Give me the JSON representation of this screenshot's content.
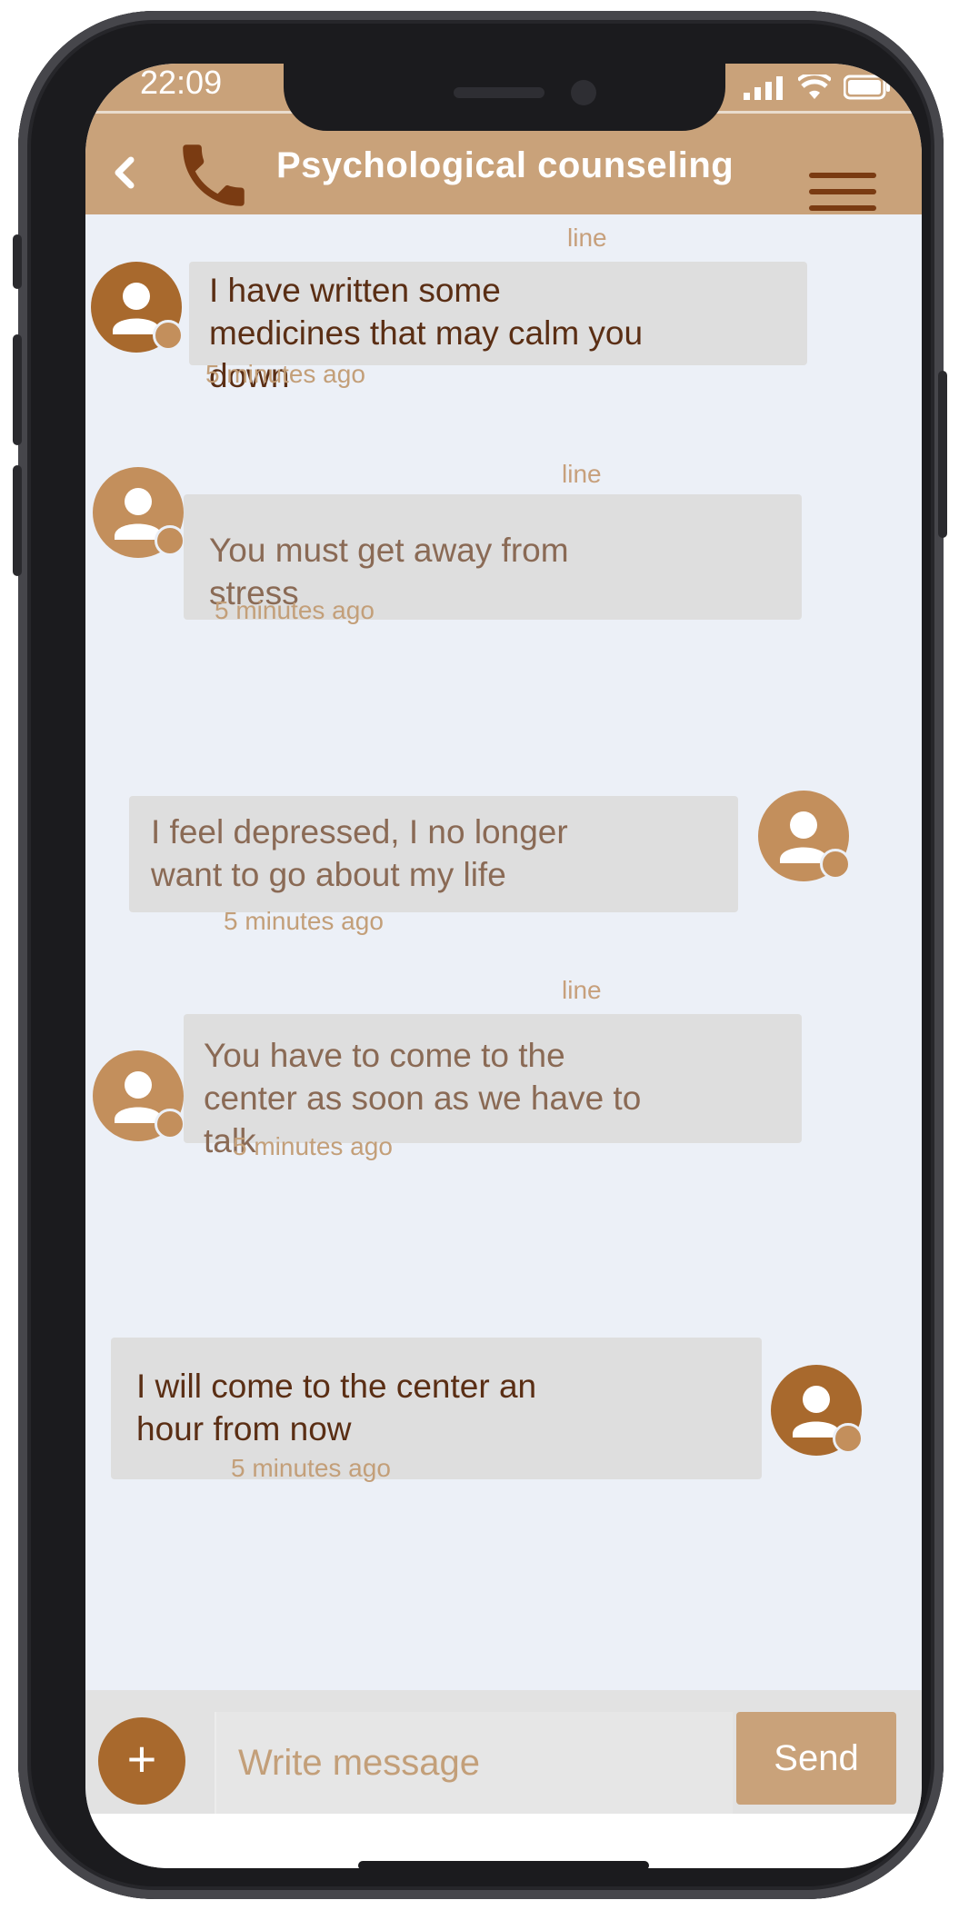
{
  "status_bar": {
    "time": "22:09",
    "signal_icon": "cellular-signal-icon",
    "wifi_icon": "wifi-icon",
    "battery_icon": "battery-icon"
  },
  "header": {
    "title": "Psychological counseling",
    "back_icon": "chevron-left-icon",
    "call_icon": "phone-icon",
    "menu_icon": "hamburger-menu-icon"
  },
  "colors": {
    "header_bg": "#c9a27a",
    "accent_dark": "#7a3b12",
    "avatar_dark": "#a8692d",
    "avatar_light": "#c38f5c",
    "bubble_bg": "#dedede",
    "chat_bg": "#ecf0f7",
    "timestamp": "#c39f79",
    "text_dark": "#5a2e14",
    "text_muted": "#8a6a55"
  },
  "messages": [
    {
      "sender": "counselor",
      "label": "line",
      "lines": [
        "I have written some",
        "medicines that may calm you",
        "down"
      ],
      "time": "5 minutes ago"
    },
    {
      "sender": "counselor",
      "label": "line",
      "lines": [
        "You must get away from",
        "stress"
      ],
      "time": "5 minutes ago"
    },
    {
      "sender": "user",
      "label": "",
      "lines": [
        "I feel depressed, I no longer",
        "want to go about my life"
      ],
      "time": "5 minutes ago"
    },
    {
      "sender": "counselor",
      "label": "line",
      "lines": [
        "You have to come to the",
        "center as soon as we have to",
        "talk"
      ],
      "time": "5 minutes ago"
    },
    {
      "sender": "user",
      "label": "",
      "lines": [
        "I will come to the center an",
        "hour from now"
      ],
      "time": "5 minutes ago"
    }
  ],
  "composer": {
    "add_label": "+",
    "placeholder": "Write message",
    "send_label": "Send"
  }
}
